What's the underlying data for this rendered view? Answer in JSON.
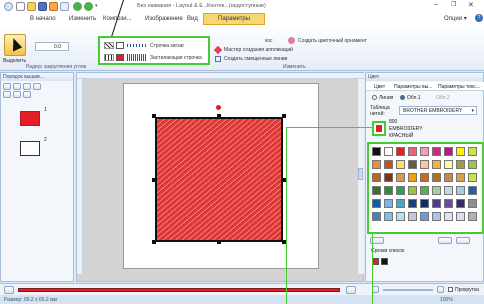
{
  "window": {
    "title": "Без названия - Layout & E...",
    "context_tab": "Контек...(недоступные)",
    "minimize": "–",
    "restore": "❐",
    "close": "✕"
  },
  "tabs": {
    "home": "В начало",
    "edit": "Изменить",
    "compose": "Компози...",
    "image": "Изображение",
    "view": "Вид",
    "params": "Параметры",
    "options": "Опции ▾",
    "help": "?"
  },
  "ribbon": {
    "select_label": "Выделить",
    "width_value": "0.0",
    "radius_label": "Радиус закругления углов",
    "stitch_zigzag": "Строчка зигзаг",
    "stitch_satin": "Застилающая строчка",
    "create_pattern": "Создать цветочный орнамент",
    "applique_wizard": "Мастер создания аппликаций",
    "offset_lines": "Создать смещенные линии",
    "group_edit": "Изменить",
    "box_label": "кос"
  },
  "left_panel": {
    "title": "Порядок вышив...",
    "page1": "1",
    "page2": "2"
  },
  "right_panel": {
    "tab_color": "Цвет",
    "tab_params": "Параметры вы...",
    "tab_all": "Параметры текс...",
    "radio_line": "Линия",
    "radio_area": "Обл.1",
    "radio_area2": "Обл.2",
    "table_label": "Таблица нитей:",
    "table_value": "BROTHER EMBROIDERY",
    "thread_number": "800",
    "thread_brand": "EMBROIDERY",
    "thread_name": "КРАСНЫЙ",
    "recent_label": "Срезки список",
    "stitch_label": "Прокрутка"
  },
  "status": {
    "left": "Размер: 65.2 x 65.2 мм",
    "zoom": "100%"
  },
  "colors": {
    "accent": "#45cc33",
    "red": "#e41e26",
    "palette": [
      "#111111",
      "#ffffff",
      "#e31e25",
      "#e8647a",
      "#f49ac1",
      "#d5257d",
      "#b5168c",
      "#fbf10a",
      "#c6e83a",
      "#e98f3c",
      "#c6521c",
      "#fce26a",
      "#6b5b3a",
      "#f7c8a0",
      "#f9b233",
      "#fff9a8",
      "#9c9c4c",
      "#9cc54b",
      "#b66a24",
      "#7a3512",
      "#d29b4e",
      "#f2a100",
      "#c86d1a",
      "#b3701e",
      "#c08b4f",
      "#d3a14c",
      "#c6e24e",
      "#3a6f32",
      "#2e8b3a",
      "#2a9f57",
      "#9dc43a",
      "#58b04f",
      "#9ed1a0",
      "#c2d8e1",
      "#a9c9e8",
      "#1d63a8",
      "#0d5ea8",
      "#7fb4e2",
      "#48a9c5",
      "#1a3f84",
      "#0b2d6b",
      "#4d3a91",
      "#6c4aa3",
      "#3a2a6b",
      "#8f8f8f",
      "#4f7fb8",
      "#7cc0e8",
      "#b7e1f2",
      "#c7c3e1",
      "#6a9fd6",
      "#a7c5ee",
      "#d7e4f6",
      "#e1dbf0",
      "#b2b2b2"
    ]
  }
}
